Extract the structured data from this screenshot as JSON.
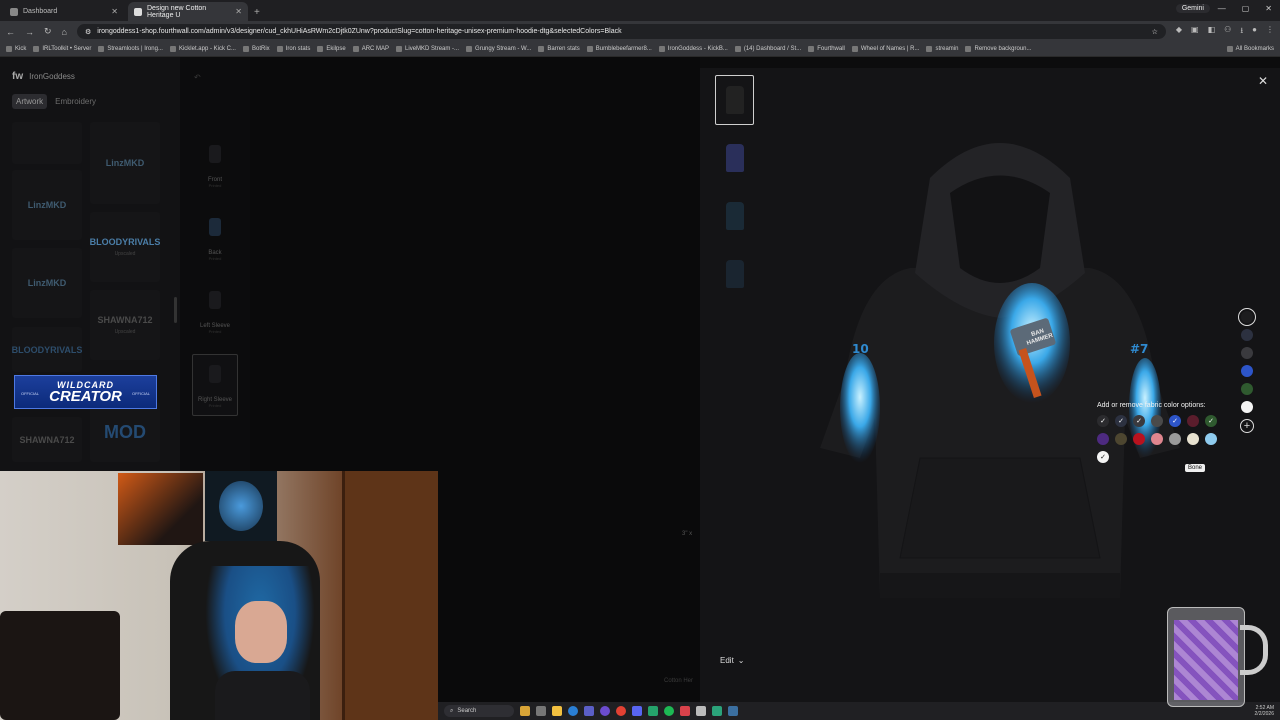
{
  "browser": {
    "tabs": [
      {
        "label": "Dashboard",
        "active": false
      },
      {
        "label": "Design new Cotton Heritage U",
        "active": true
      }
    ],
    "gemini_label": "Gemini",
    "url": "irongoddess1-shop.fourthwall.com/admin/v3/designer/cud_ckhUHiAsRWm2cDjtk0ZUnw?productSlug=cotton-heritage-unisex-premium-hoodie-dtg&selectedColors=Black",
    "bookmarks": [
      "Kick",
      "IRLToolkit • Server",
      "Streamloots | Irong...",
      "Kicklet.app - Kick C...",
      "BotRix",
      "Iron stats",
      "Ekilpse",
      "ARC MAP",
      "LiveMKD Stream -...",
      "Grungy Stream - W...",
      "Barren stats",
      "Bumblebeefarmer8...",
      "IronGoddess - KickB...",
      "(14) Dashboard / St...",
      "Fourthwall",
      "Wheel of Names | R...",
      "streamin",
      "Remove backgroun..."
    ],
    "all_bookmarks": "All Bookmarks"
  },
  "sidebar": {
    "store_name": "IronGoddess",
    "tabs": [
      "Artwork",
      "Embroidery"
    ],
    "thumbnails": [
      {
        "text": "LinzMKD",
        "note": ""
      },
      {
        "text": "LinzMKD",
        "note": ""
      },
      {
        "text": "BLOODYRIVALS",
        "note": "Upscaled"
      },
      {
        "text": "LinzMKD",
        "note": ""
      },
      {
        "text": "SHAWNA712",
        "note": "Upscaled"
      },
      {
        "text": "BLOODYRIVALS",
        "note": ""
      },
      {
        "text": "SHAWNA712",
        "note": ""
      },
      {
        "text": "MOD",
        "note": ""
      }
    ],
    "banner": {
      "line1": "WILDCARD",
      "line2": "CREATOR",
      "tag": "OFFICIAL"
    }
  },
  "views": [
    {
      "label": "Front",
      "status": "Printed"
    },
    {
      "label": "Back",
      "status": "Printed"
    },
    {
      "label": "Left Sleeve",
      "status": "Printed"
    },
    {
      "label": "Right Sleeve",
      "status": "Printed"
    }
  ],
  "canvas": {
    "scale_label": "3\" x",
    "bottom_label": "Cotton Her"
  },
  "modal": {
    "close_label": "✕",
    "edit_label": "Edit",
    "fabric_popover": {
      "title": "Add or remove fabric color options:",
      "colors": [
        {
          "hex": "#2b2b2e",
          "checked": true
        },
        {
          "hex": "#2c3140",
          "checked": true
        },
        {
          "hex": "#3a3a3e",
          "checked": true
        },
        {
          "hex": "#4a4a4a",
          "checked": false
        },
        {
          "hex": "#2d55c9",
          "checked": true
        },
        {
          "hex": "#5b1d2c",
          "checked": false
        },
        {
          "hex": "#2f5a2f",
          "checked": true
        },
        {
          "hex": "#4d2a80",
          "checked": false
        },
        {
          "hex": "#4d4630",
          "checked": false
        },
        {
          "hex": "#b8121e",
          "checked": false
        },
        {
          "hex": "#e0868f",
          "checked": false
        },
        {
          "hex": "#9a9a9a",
          "checked": false
        },
        {
          "hex": "#e8e2d0",
          "checked": false
        },
        {
          "hex": "#8fcbee",
          "checked": false
        },
        {
          "hex": "#f5f5f5",
          "checked": true
        }
      ],
      "tooltip": "Bone"
    },
    "selected_colors": [
      "#1d1d1f",
      "#2c3140",
      "#3a3a3e",
      "#2d55c9",
      "#2f5a2f",
      "#f5f5f5"
    ],
    "print_text": "BAN HAMMER"
  },
  "taskbar": {
    "search": "Search",
    "time": "2:52 AM",
    "date": "2/2/2026"
  }
}
